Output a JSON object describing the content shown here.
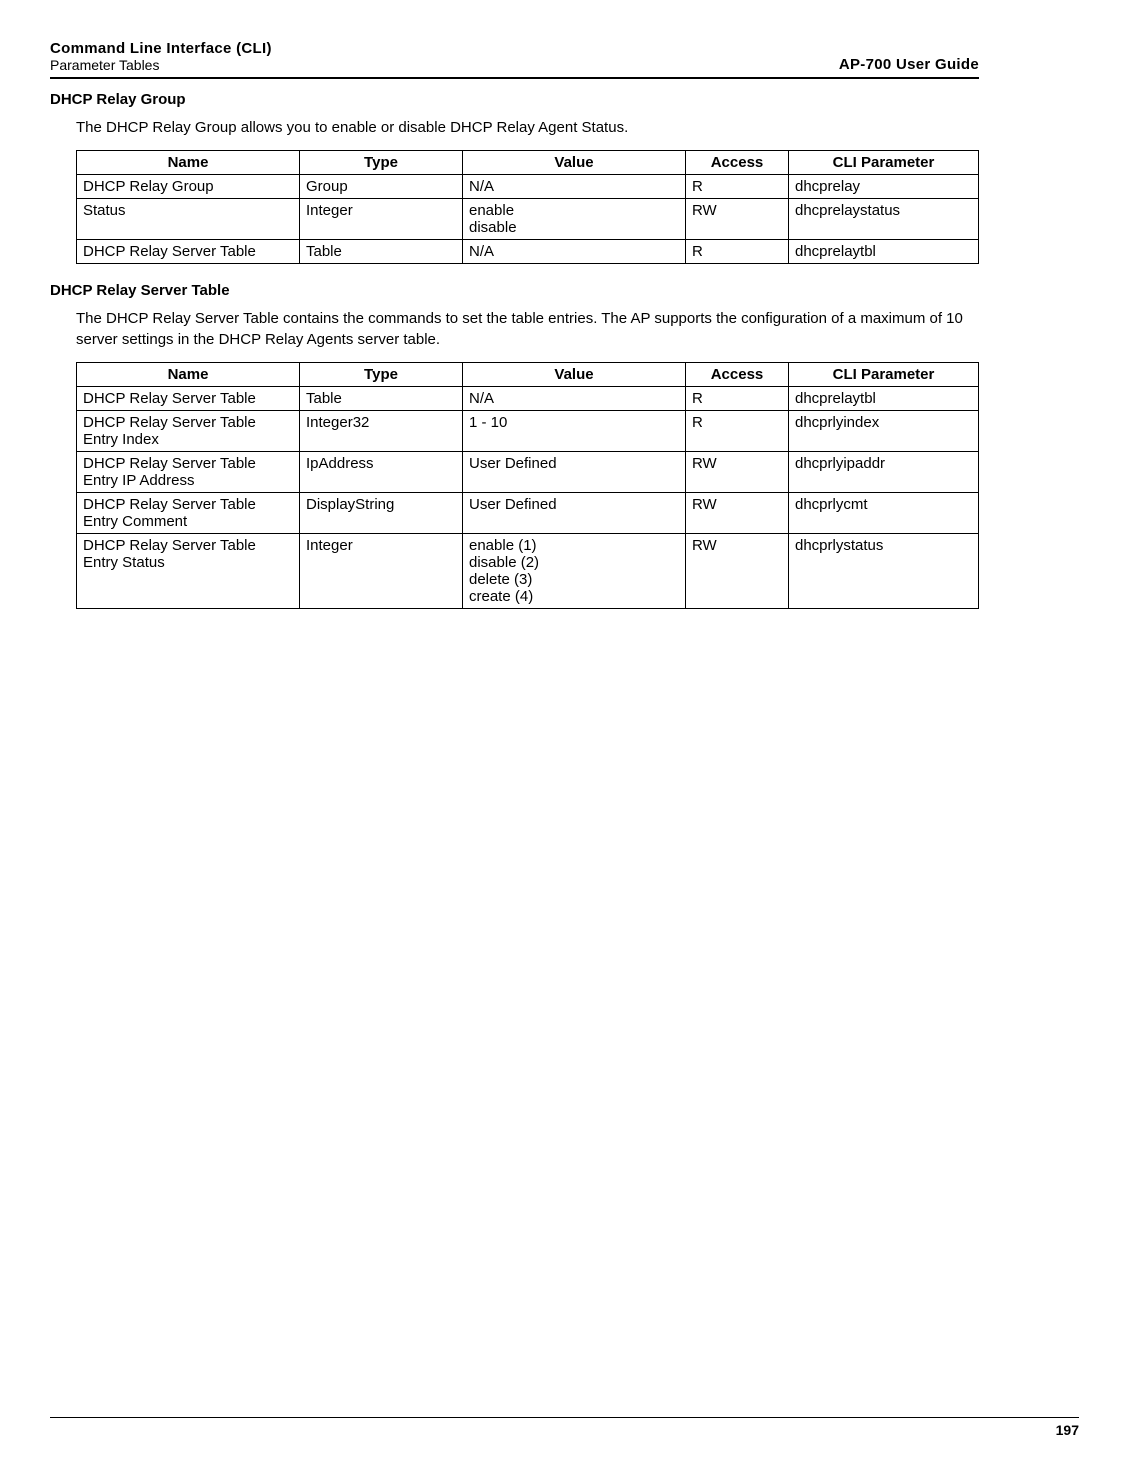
{
  "header": {
    "left_top": "Command Line Interface (CLI)",
    "left_bottom": "Parameter Tables",
    "right": "AP-700 User Guide"
  },
  "section1": {
    "title": "DHCP Relay Group",
    "text": "The DHCP Relay Group allows you to enable or disable DHCP Relay Agent Status."
  },
  "table_headers": {
    "name": "Name",
    "type": "Type",
    "value": "Value",
    "access": "Access",
    "cli": "CLI Parameter"
  },
  "table1": [
    {
      "name": "DHCP Relay Group",
      "type": "Group",
      "value": "N/A",
      "access": "R",
      "cli": "dhcprelay"
    },
    {
      "name": "Status",
      "type": "Integer",
      "value": "enable\ndisable",
      "access": "RW",
      "cli": "dhcprelaystatus"
    },
    {
      "name": "DHCP Relay Server Table",
      "type": "Table",
      "value": "N/A",
      "access": "R",
      "cli": "dhcprelaytbl"
    }
  ],
  "section2": {
    "title": "DHCP Relay Server Table",
    "text": "The DHCP Relay Server Table contains the commands to set the table entries. The AP supports the configuration of a maximum of 10 server settings in the DHCP Relay Agents server table."
  },
  "table2": [
    {
      "name": "DHCP Relay Server Table",
      "type": "Table",
      "value": "N/A",
      "access": "R",
      "cli": "dhcprelaytbl"
    },
    {
      "name": "DHCP Relay Server Table Entry Index",
      "type": "Integer32",
      "value": "1 - 10",
      "access": "R",
      "cli": "dhcprlyindex"
    },
    {
      "name": "DHCP Relay Server Table Entry IP Address",
      "type": "IpAddress",
      "value": "User Defined",
      "access": "RW",
      "cli": "dhcprlyipaddr"
    },
    {
      "name": "DHCP Relay Server Table Entry Comment",
      "type": "DisplayString",
      "value": "User Defined",
      "access": "RW",
      "cli": "dhcprlycmt"
    },
    {
      "name": "DHCP Relay Server Table Entry Status",
      "type": "Integer",
      "value": "enable (1)\ndisable (2)\ndelete (3)\ncreate (4)",
      "access": "RW",
      "cli": "dhcprlystatus"
    }
  ],
  "footer": {
    "page": "197"
  }
}
